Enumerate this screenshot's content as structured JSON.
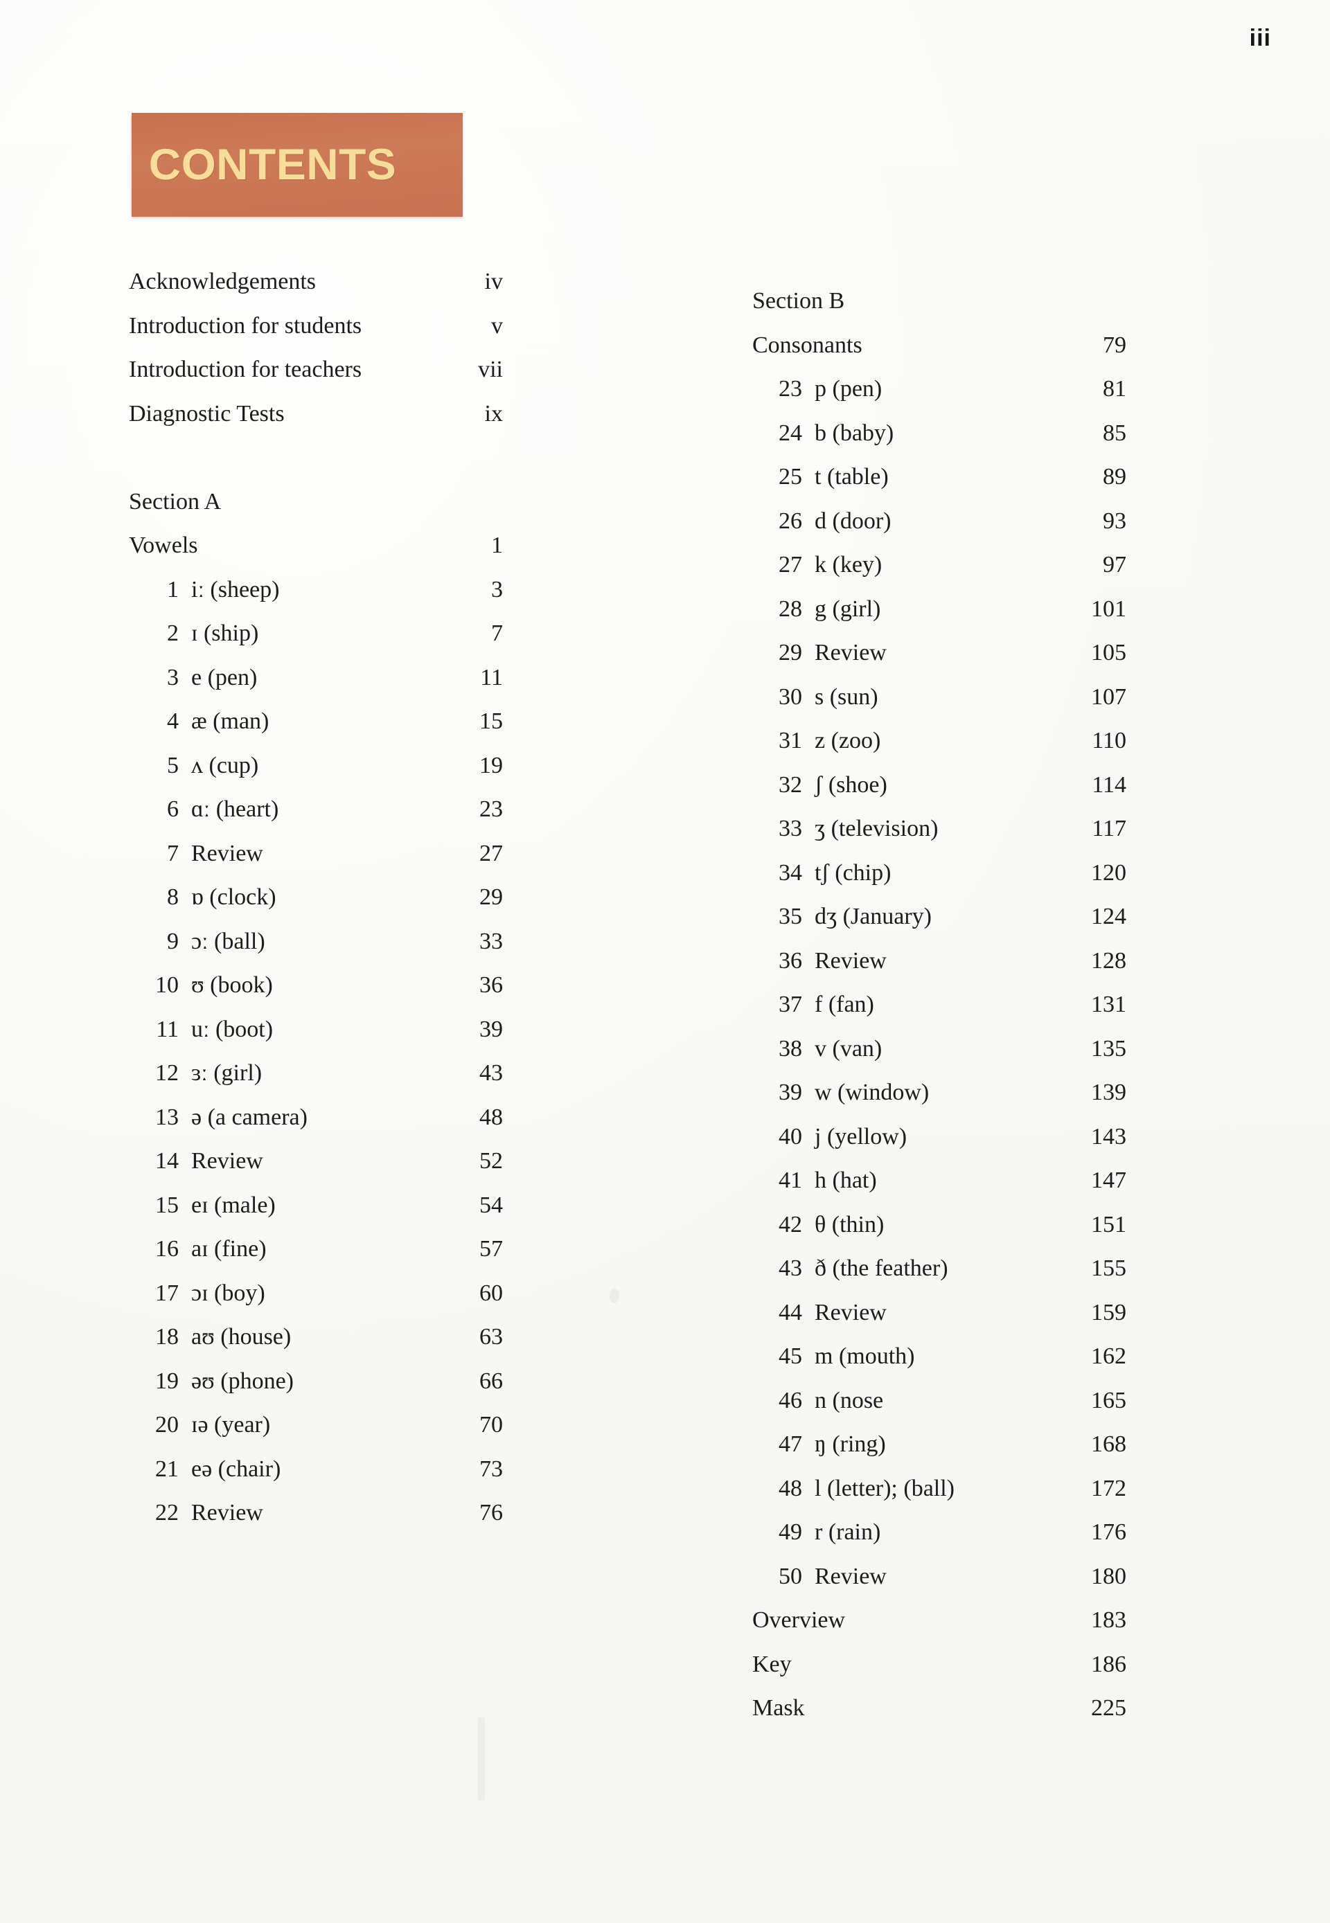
{
  "folio": "iii",
  "banner": {
    "title": "CONTENTS",
    "bg_color": "#c8724f",
    "text_color": "#f7dd9a"
  },
  "left_column": {
    "front_matter": [
      {
        "label": "Acknowledgements",
        "page": "iv"
      },
      {
        "label": "Introduction for students",
        "page": "v"
      },
      {
        "label": "Introduction for teachers",
        "page": "vii"
      },
      {
        "label": "Diagnostic Tests",
        "page": "ix"
      }
    ],
    "section_label": "Section A",
    "group_label": "Vowels",
    "group_page": "1",
    "entries": [
      {
        "num": "1",
        "label": "iː (sheep)",
        "page": "3"
      },
      {
        "num": "2",
        "label": "ɪ (ship)",
        "page": "7"
      },
      {
        "num": "3",
        "label": "e (pen)",
        "page": "11"
      },
      {
        "num": "4",
        "label": "æ (man)",
        "page": "15"
      },
      {
        "num": "5",
        "label": "ʌ (cup)",
        "page": "19"
      },
      {
        "num": "6",
        "label": "ɑː (heart)",
        "page": "23"
      },
      {
        "num": "7",
        "label": "Review",
        "page": "27"
      },
      {
        "num": "8",
        "label": "ɒ (clock)",
        "page": "29"
      },
      {
        "num": "9",
        "label": "ɔː (ball)",
        "page": "33"
      },
      {
        "num": "10",
        "label": "ʊ (book)",
        "page": "36"
      },
      {
        "num": "11",
        "label": "uː (boot)",
        "page": "39"
      },
      {
        "num": "12",
        "label": "ɜː (girl)",
        "page": "43"
      },
      {
        "num": "13",
        "label": "ə (a camera)",
        "page": "48"
      },
      {
        "num": "14",
        "label": "Review",
        "page": "52"
      },
      {
        "num": "15",
        "label": "eɪ (male)",
        "page": "54"
      },
      {
        "num": "16",
        "label": "aɪ (fine)",
        "page": "57"
      },
      {
        "num": "17",
        "label": "ɔɪ (boy)",
        "page": "60"
      },
      {
        "num": "18",
        "label": "aʊ (house)",
        "page": "63"
      },
      {
        "num": "19",
        "label": "əʊ (phone)",
        "page": "66"
      },
      {
        "num": "20",
        "label": "ɪə (year)",
        "page": "70"
      },
      {
        "num": "21",
        "label": "eə (chair)",
        "page": "73"
      },
      {
        "num": "22",
        "label": "Review",
        "page": "76"
      }
    ]
  },
  "right_column": {
    "section_label": "Section B",
    "group_label": "Consonants",
    "group_page": "79",
    "entries": [
      {
        "num": "23",
        "label": "p (pen)",
        "page": "81"
      },
      {
        "num": "24",
        "label": "b (baby)",
        "page": "85"
      },
      {
        "num": "25",
        "label": "t (table)",
        "page": "89"
      },
      {
        "num": "26",
        "label": "d (door)",
        "page": "93"
      },
      {
        "num": "27",
        "label": "k (key)",
        "page": "97"
      },
      {
        "num": "28",
        "label": "g (girl)",
        "page": "101"
      },
      {
        "num": "29",
        "label": "Review",
        "page": "105"
      },
      {
        "num": "30",
        "label": "s (sun)",
        "page": "107"
      },
      {
        "num": "31",
        "label": "z (zoo)",
        "page": "110"
      },
      {
        "num": "32",
        "label": "ʃ (shoe)",
        "page": "114"
      },
      {
        "num": "33",
        "label": "ʒ (television)",
        "page": "117"
      },
      {
        "num": "34",
        "label": "tʃ (chip)",
        "page": "120"
      },
      {
        "num": "35",
        "label": "dʒ (January)",
        "page": "124"
      },
      {
        "num": "36",
        "label": "Review",
        "page": "128"
      },
      {
        "num": "37",
        "label": "f (fan)",
        "page": "131"
      },
      {
        "num": "38",
        "label": "v (van)",
        "page": "135"
      },
      {
        "num": "39",
        "label": "w (window)",
        "page": "139"
      },
      {
        "num": "40",
        "label": "j (yellow)",
        "page": "143"
      },
      {
        "num": "41",
        "label": "h (hat)",
        "page": "147"
      },
      {
        "num": "42",
        "label": "θ (thin)",
        "page": "151"
      },
      {
        "num": "43",
        "label": "ð (the feather)",
        "page": "155"
      },
      {
        "num": "44",
        "label": "Review",
        "page": "159"
      },
      {
        "num": "45",
        "label": "m (mouth)",
        "page": "162"
      },
      {
        "num": "46",
        "label": "n (nose",
        "page": "165"
      },
      {
        "num": "47",
        "label": "ŋ (ring)",
        "page": "168"
      },
      {
        "num": "48",
        "label": "l (letter); (ball)",
        "page": "172"
      },
      {
        "num": "49",
        "label": "r (rain)",
        "page": "176"
      },
      {
        "num": "50",
        "label": "Review",
        "page": "180"
      }
    ],
    "back_matter": [
      {
        "label": "Overview",
        "page": "183"
      },
      {
        "label": "Key",
        "page": "186"
      },
      {
        "label": "Mask",
        "page": "225"
      }
    ]
  }
}
